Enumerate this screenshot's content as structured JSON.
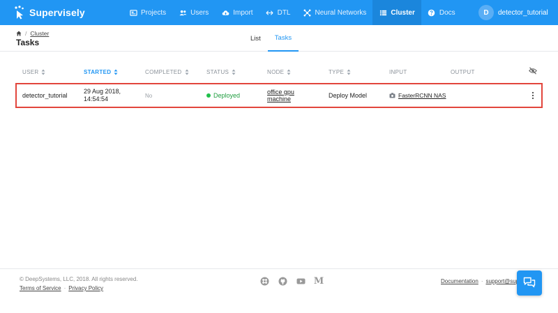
{
  "brand": {
    "name": "Supervisely",
    "color": "#2196f3"
  },
  "nav": {
    "items": [
      {
        "label": "Projects",
        "icon": "projects-icon"
      },
      {
        "label": "Users",
        "icon": "users-icon"
      },
      {
        "label": "Import",
        "icon": "cloud-upload-icon"
      },
      {
        "label": "DTL",
        "icon": "dtl-arrows-icon"
      },
      {
        "label": "Neural Networks",
        "icon": "neural-networks-icon"
      },
      {
        "label": "Cluster",
        "icon": "cluster-list-icon",
        "active": true
      },
      {
        "label": "Docs",
        "icon": "help-icon"
      }
    ]
  },
  "user": {
    "initial": "D",
    "name": "detector_tutorial"
  },
  "breadcrumb": {
    "crumb": "Cluster"
  },
  "page": {
    "title": "Tasks"
  },
  "tabs": [
    {
      "label": "List"
    },
    {
      "label": "Tasks",
      "active": true
    }
  ],
  "table": {
    "columns": [
      "USER",
      "STARTED",
      "COMPLETED",
      "STATUS",
      "NODE",
      "TYPE",
      "INPUT",
      "OUTPUT"
    ],
    "sorted_column": "STARTED",
    "rows": [
      {
        "user": "detector_tutorial",
        "started_date": "29 Aug 2018,",
        "started_time": "14:54:54",
        "completed": "No",
        "status": "Deployed",
        "node_line1": "office gpu",
        "node_line2": "machine",
        "type": "Deploy Model",
        "input": "FasterRCNN NAS",
        "output": ""
      }
    ]
  },
  "footer": {
    "copyright": "© DeepSystems, LLC, 2018. All rights reserved.",
    "terms": "Terms of Service",
    "privacy": "Privacy Policy",
    "documentation": "Documentation",
    "support": "support@sup",
    "social": [
      "slack-icon",
      "github-icon",
      "youtube-icon",
      "medium-icon"
    ],
    "medium_letter": "M"
  },
  "colors": {
    "accent": "#2196f3",
    "status_ok": "#20c04a",
    "highlight": "#e2453c"
  }
}
